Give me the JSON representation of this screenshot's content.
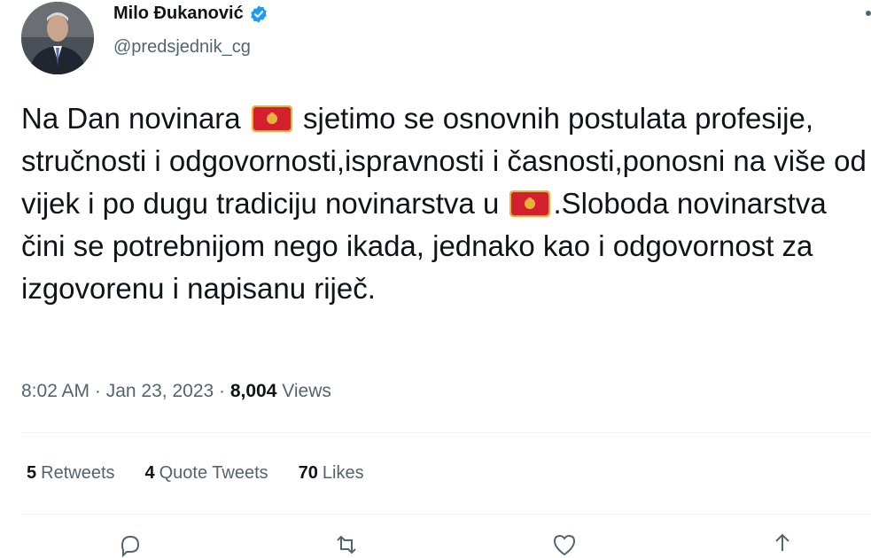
{
  "author": {
    "name": "Milo Đukanović",
    "handle": "@predsjednik_cg"
  },
  "tweet": {
    "text_part1": "Na Dan novinara",
    "text_part2": " sjetimo se osnovnih postulata profesije, stručnosti i odgovornosti,ispravnosti i časnosti,ponosni na više od vijek i po dugu tradiciju novinarstva u",
    "text_part3": ".Sloboda novinarstva čini se potrebnijom nego ikada, jednako kao i odgovornost za izgovorenu i napisanu riječ.",
    "flag_icon": "montenegro-flag-emoji"
  },
  "meta": {
    "time": "8:02 AM",
    "separator1": " · ",
    "date": "Jan 23, 2023",
    "separator2": " · ",
    "views_count": "8,004",
    "views_label": " Views"
  },
  "stats": {
    "retweets_count": "5",
    "retweets_label": "Retweets",
    "quotes_count": "4",
    "quotes_label": "Quote Tweets",
    "likes_count": "70",
    "likes_label": "Likes"
  },
  "actions": [
    "reply-icon",
    "retweet-icon",
    "like-icon",
    "share-icon"
  ],
  "colors": {
    "text": "#0f1419",
    "secondary": "#536471",
    "verified": "#1d9bf0",
    "flag_red": "#d3202e",
    "flag_gold": "#e8b33b"
  }
}
